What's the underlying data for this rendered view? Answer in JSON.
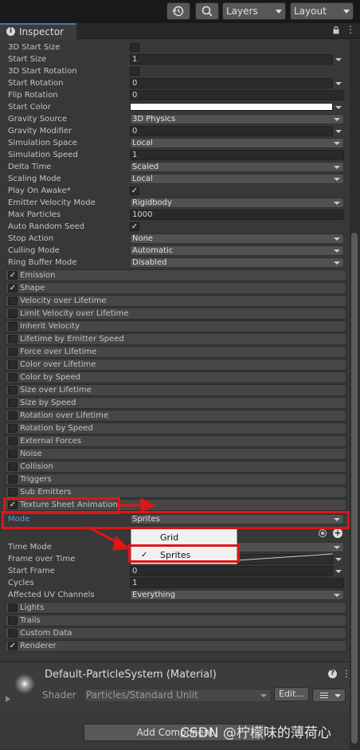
{
  "toolbar": {
    "layers_label": "Layers",
    "layout_label": "Layout",
    "history_icon": "history-icon",
    "search_icon": "search-icon"
  },
  "tab": {
    "title": "Inspector",
    "icon": "info-icon"
  },
  "main_rows": [
    {
      "label": "3D Start Size",
      "kind": "checkbox",
      "checked": false
    },
    {
      "label": "Start Size",
      "kind": "num",
      "value": "1"
    },
    {
      "label": "3D Start Rotation",
      "kind": "checkbox",
      "checked": false
    },
    {
      "label": "Start Rotation",
      "kind": "num",
      "value": "0"
    },
    {
      "label": "Flip Rotation",
      "kind": "field",
      "value": "0"
    },
    {
      "label": "Start Color",
      "kind": "color",
      "value": "#ffffff"
    },
    {
      "label": "Gravity Source",
      "kind": "dropdown",
      "value": "3D Physics"
    },
    {
      "label": "Gravity Modifier",
      "kind": "num",
      "value": "0"
    },
    {
      "label": "Simulation Space",
      "kind": "dropdown",
      "value": "Local"
    },
    {
      "label": "Simulation Speed",
      "kind": "field",
      "value": "1"
    },
    {
      "label": "Delta Time",
      "kind": "dropdown",
      "value": "Scaled"
    },
    {
      "label": "Scaling Mode",
      "kind": "dropdown",
      "value": "Local"
    },
    {
      "label": "Play On Awake*",
      "kind": "checkbox",
      "checked": true
    },
    {
      "label": "Emitter Velocity Mode",
      "kind": "dropdown",
      "value": "Rigidbody"
    },
    {
      "label": "Max Particles",
      "kind": "field",
      "value": "1000"
    },
    {
      "label": "Auto Random Seed",
      "kind": "checkbox",
      "checked": true
    },
    {
      "label": "Stop Action",
      "kind": "dropdown",
      "value": "None"
    },
    {
      "label": "Culling Mode",
      "kind": "dropdown",
      "value": "Automatic"
    },
    {
      "label": "Ring Buffer Mode",
      "kind": "dropdown",
      "value": "Disabled"
    }
  ],
  "modules": [
    {
      "label": "Emission",
      "checked": true
    },
    {
      "label": "Shape",
      "checked": true
    },
    {
      "label": "Velocity over Lifetime",
      "checked": false
    },
    {
      "label": "Limit Velocity over Lifetime",
      "checked": false
    },
    {
      "label": "Inherit Velocity",
      "checked": false
    },
    {
      "label": "Lifetime by Emitter Speed",
      "checked": false
    },
    {
      "label": "Force over Lifetime",
      "checked": false
    },
    {
      "label": "Color over Lifetime",
      "checked": false
    },
    {
      "label": "Color by Speed",
      "checked": false
    },
    {
      "label": "Size over Lifetime",
      "checked": false
    },
    {
      "label": "Size by Speed",
      "checked": false
    },
    {
      "label": "Rotation over Lifetime",
      "checked": false
    },
    {
      "label": "Rotation by Speed",
      "checked": false
    },
    {
      "label": "External Forces",
      "checked": false
    },
    {
      "label": "Noise",
      "checked": false
    },
    {
      "label": "Collision",
      "checked": false
    },
    {
      "label": "Triggers",
      "checked": false
    },
    {
      "label": "Sub Emitters",
      "checked": false
    },
    {
      "label": "Texture Sheet Animation",
      "checked": true
    }
  ],
  "tsa": {
    "mode_label": "Mode",
    "mode_value": "Sprites",
    "rows": [
      {
        "label": "Time Mode",
        "kind": "dropdown",
        "value": ""
      },
      {
        "label": "Frame over Time",
        "kind": "curve",
        "value": ""
      },
      {
        "label": "Start Frame",
        "kind": "num",
        "value": "0"
      },
      {
        "label": "Cycles",
        "kind": "field",
        "value": "1"
      },
      {
        "label": "Affected UV Channels",
        "kind": "dropdown",
        "value": "Everything"
      }
    ]
  },
  "bottom_modules": [
    {
      "label": "Lights",
      "checked": false
    },
    {
      "label": "Trails",
      "checked": false
    },
    {
      "label": "Custom Data",
      "checked": false
    },
    {
      "label": "Renderer",
      "checked": true
    }
  ],
  "popup": {
    "options": [
      {
        "label": "Grid",
        "selected": false
      },
      {
        "label": "Sprites",
        "selected": true
      }
    ]
  },
  "material": {
    "name": "Default-ParticleSystem (Material)",
    "shader_label": "Shader",
    "shader_value": "Particles/Standard Unlit",
    "edit_label": "Edit..."
  },
  "add_component_label": "Add Component",
  "watermark": "CSDN @柠檬味的薄荷心",
  "colors": {
    "highlight": "#e01515",
    "accent": "#3a79bb",
    "mode_label": "#5b9ee0"
  }
}
